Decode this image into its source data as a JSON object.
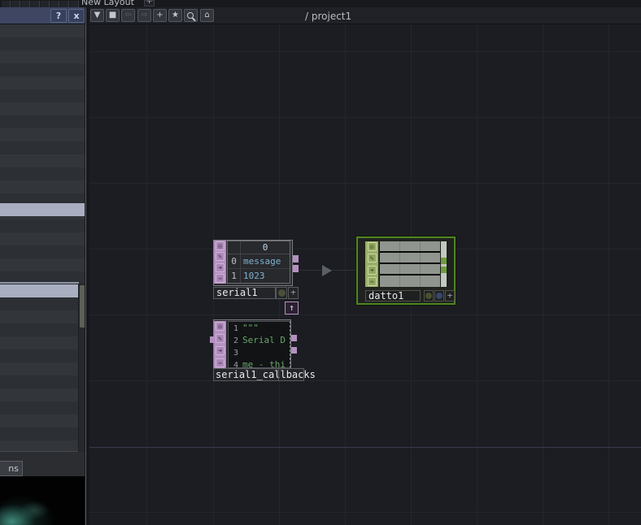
{
  "tab_bar": {
    "active_tab": "New Layout",
    "add_button": "+"
  },
  "panel_header": {
    "help": "?",
    "close": "x"
  },
  "toolbar": {
    "dropdown": "▼",
    "stop": "■",
    "back": "⇦",
    "forward": "⇨",
    "add": "+",
    "bookmark": "★",
    "home": "⌂",
    "path": "/ project1"
  },
  "left_panel": {
    "bottom_tab": "ns"
  },
  "flags": {
    "viewer": "◎",
    "edit": "✎",
    "export": "➜",
    "bypass": "✑"
  },
  "nodes": {
    "serial1": {
      "label": "serial1",
      "plus": "+",
      "dock_arrow": "↑",
      "table": {
        "col_header": "0",
        "rows": [
          {
            "n": "0",
            "v": "message"
          },
          {
            "n": "1",
            "v": "1023"
          }
        ]
      }
    },
    "datto1": {
      "label": "datto1",
      "plus": "+"
    },
    "serial1_callbacks": {
      "label": "serial1_callbacks",
      "lines": [
        {
          "n": "1",
          "t": "\"\"\""
        },
        {
          "n": "2",
          "t": "Serial D"
        },
        {
          "n": "3",
          "t": ""
        },
        {
          "n": "4",
          "t": "me - thi"
        }
      ]
    }
  },
  "colors": {
    "selection_green": "#4f8524",
    "node_pink": "#b590c1",
    "node_green_strip": "#99b065",
    "value_blue": "#7fb2d2",
    "code_green": "#68a766",
    "highlight_row": "#a9afc0",
    "panel_header_blue": "#3e4662"
  }
}
